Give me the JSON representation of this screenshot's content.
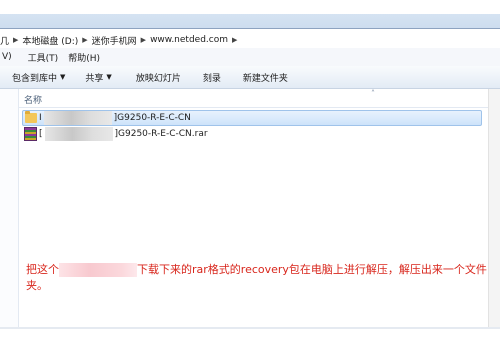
{
  "address": {
    "crumbs": [
      "几",
      "本地磁盘 (D:)",
      "迷你手机网",
      "www.netded.com"
    ]
  },
  "menu": {
    "items": [
      "V)",
      "工具(T)",
      "帮助(H)"
    ]
  },
  "toolbar": {
    "include_library": "包含到库中",
    "share": "共享",
    "slideshow": "放映幻灯片",
    "burn": "刻录",
    "new_folder": "新建文件夹"
  },
  "list": {
    "column_name": "名称",
    "files": [
      {
        "prefix": "I",
        "name": "]G9250-R-E-C-CN",
        "icon": "folder-icon",
        "selected": true
      },
      {
        "prefix": "[",
        "name": "]G9250-R-E-C-CN.rar",
        "icon": "winrar-archive-icon",
        "selected": false
      }
    ]
  },
  "annotation": {
    "part1": "把这个",
    "part2": "下载下来的rar格式的recovery包在电脑上进行解压，解压出来一个文件夹。",
    "color": "#d8261c"
  }
}
